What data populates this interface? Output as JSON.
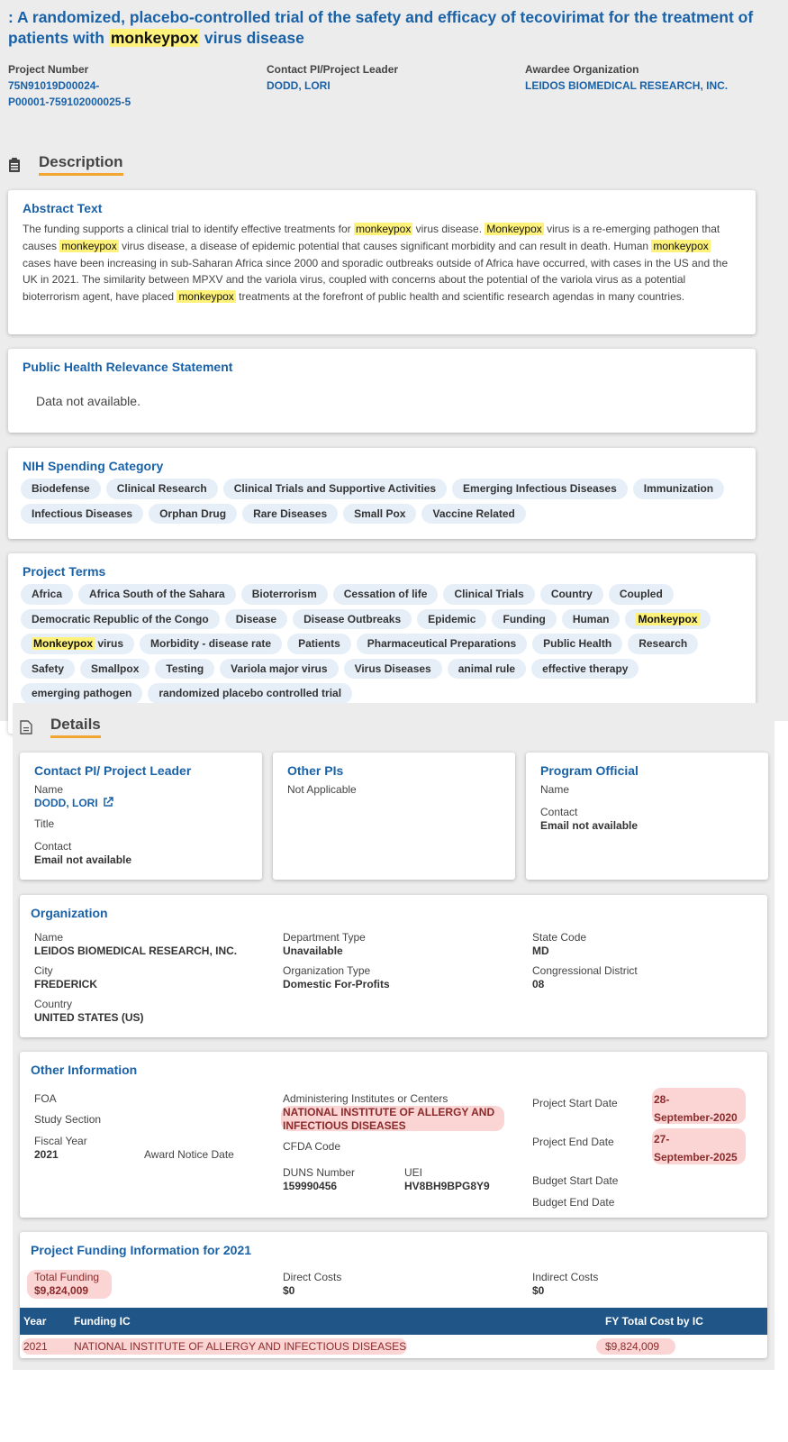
{
  "header": {
    "title_pre": ": A randomized, placebo-controlled trial of the safety and efficacy of tecovirimat for the treatment of patients with ",
    "title_hl": "monkeypox",
    "title_post": " virus disease",
    "project_number_label": "Project Number",
    "project_number_1": "75N91019D00024-",
    "project_number_2": "P00001-759102000025-5",
    "contact_label": "Contact PI/Project Leader",
    "contact_value": "DODD, LORI",
    "awardee_label": "Awardee Organization",
    "awardee_value": "LEIDOS BIOMEDICAL RESEARCH, INC."
  },
  "description": {
    "heading": "Description",
    "abstract_title": "Abstract Text",
    "abstract_segments": [
      {
        "t": "The funding supports a clinical trial to identify effective treatments for ",
        "hl": false
      },
      {
        "t": "monkeypox",
        "hl": true
      },
      {
        "t": " virus disease. ",
        "hl": false
      },
      {
        "t": "Monkeypox",
        "hl": true
      },
      {
        "t": " virus is a re-emerging pathogen that causes ",
        "hl": false
      },
      {
        "t": "monkeypox",
        "hl": true
      },
      {
        "t": " virus disease, a disease of epidemic potential that causes significant morbidity and can result in death. Human ",
        "hl": false
      },
      {
        "t": "monkeypox",
        "hl": true
      },
      {
        "t": " cases have been increasing in sub-Saharan Africa since 2000 and sporadic outbreaks outside of Africa have occurred, with cases in the US and the UK in 2021. The similarity between MPXV and the variola virus, coupled with concerns about the potential of the variola virus as a potential bioterrorism agent, have placed ",
        "hl": false
      },
      {
        "t": "monkeypox",
        "hl": true
      },
      {
        "t": " treatments at the forefront of public health and scientific research agendas in many countries.",
        "hl": false
      }
    ],
    "relevance_title": "Public Health Relevance Statement",
    "relevance_text": "Data not available.",
    "spending_title": "NIH Spending Category",
    "spending_tags": [
      "Biodefense",
      "Clinical Research",
      "Clinical Trials and Supportive Activities",
      "Emerging Infectious Diseases",
      "Immunization",
      "Infectious Diseases",
      "Orphan Drug",
      "Rare Diseases",
      "Small Pox",
      "Vaccine Related"
    ],
    "terms_title": "Project Terms",
    "terms_tags": [
      {
        "t": "Africa"
      },
      {
        "t": "Africa South of the Sahara"
      },
      {
        "t": "Bioterrorism"
      },
      {
        "t": "Cessation of life"
      },
      {
        "t": "Clinical Trials"
      },
      {
        "t": "Country"
      },
      {
        "t": "Coupled"
      },
      {
        "t": "Democratic Republic of the Congo"
      },
      {
        "t": "Disease"
      },
      {
        "t": "Disease Outbreaks"
      },
      {
        "t": "Epidemic"
      },
      {
        "t": "Funding"
      },
      {
        "t": "Human"
      },
      {
        "hl": "Monkeypox"
      },
      {
        "hl": "Monkeypox",
        "t": " virus"
      },
      {
        "t": "Morbidity - disease rate"
      },
      {
        "t": "Patients"
      },
      {
        "t": "Pharmaceutical Preparations"
      },
      {
        "t": "Public Health"
      },
      {
        "t": "Research"
      },
      {
        "t": "Safety"
      },
      {
        "t": "Smallpox"
      },
      {
        "t": "Testing"
      },
      {
        "t": "Variola major virus"
      },
      {
        "t": "Virus Diseases"
      },
      {
        "t": "animal rule"
      },
      {
        "t": "effective therapy"
      },
      {
        "t": "emerging pathogen"
      },
      {
        "t": "randomized placebo controlled trial"
      }
    ]
  },
  "details": {
    "heading": "Details",
    "contact_card_title": "Contact PI/ Project Leader",
    "name_label": "Name",
    "contact_name": "DODD, LORI",
    "title_label": "Title",
    "contact_label": "Contact",
    "email_na": "Email not available",
    "other_pis_title": "Other PIs",
    "other_pis_value": "Not Applicable",
    "program_official_title": "Program Official",
    "org_title": "Organization",
    "org_name_label": "Name",
    "org_name": "LEIDOS BIOMEDICAL RESEARCH, INC.",
    "city_label": "City",
    "city": "FREDERICK",
    "country_label": "Country",
    "country": "UNITED STATES (US)",
    "dept_type_label": "Department Type",
    "dept_type": "Unavailable",
    "org_type_label": "Organization Type",
    "org_type": "Domestic For-Profits",
    "state_code_label": "State Code",
    "state_code": "MD",
    "cong_district_label": "Congressional District",
    "cong_district": "08",
    "other_info_title": "Other Information",
    "foa_label": "FOA",
    "study_section_label": "Study Section",
    "fiscal_year_label": "Fiscal Year",
    "fiscal_year": "2021",
    "award_notice_label": "Award Notice Date",
    "admin_ic_label": "Administering Institutes or Centers",
    "admin_ic_1": "NATIONAL INSTITUTE OF ALLERGY AND",
    "admin_ic_2": "INFECTIOUS DISEASES",
    "cfda_label": "CFDA Code",
    "duns_label": "DUNS Number",
    "duns": "159990456",
    "uei_label": "UEI",
    "uei": "HV8BH9BPG8Y9",
    "start_label": "Project Start Date",
    "start_1": "28-",
    "start_2": "September-2020",
    "end_label": "Project End Date",
    "end_1": "27-",
    "end_2": "September-2025",
    "budget_start_label": "Budget Start Date",
    "budget_end_label": "Budget End Date",
    "funding_title": "Project Funding Information for 2021",
    "total_funding_label": "Total Funding",
    "total_funding": "$9,824,009",
    "direct_costs_label": "Direct Costs",
    "direct_costs": "$0",
    "indirect_costs_label": "Indirect Costs",
    "indirect_costs": "$0",
    "table_headers": [
      "Year",
      "Funding IC",
      "FY Total Cost by IC"
    ],
    "table_row": [
      "2021",
      "NATIONAL INSTITUTE OF ALLERGY AND INFECTIOUS DISEASES",
      "$9,824,009"
    ]
  },
  "colors": {
    "link": "#1a62a8",
    "accent": "#f3a531",
    "highlight": "#fff27a",
    "table_header": "#1f5587"
  }
}
